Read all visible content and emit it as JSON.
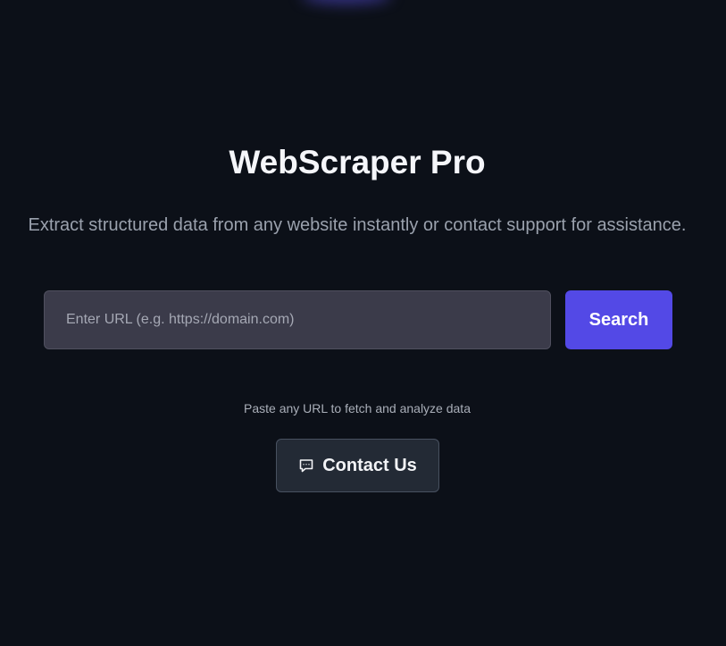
{
  "app": {
    "title": "WebScraper Pro",
    "subtitle": "Extract structured data from any website instantly or contact support for assistance."
  },
  "search": {
    "placeholder": "Enter URL (e.g. https://domain.com)",
    "value": "",
    "button_label": "Search",
    "hint": "Paste any URL to fetch and analyze data"
  },
  "contact": {
    "button_label": "Contact Us",
    "icon": "chat-bubble-icon"
  },
  "colors": {
    "background": "#0c1018",
    "accent": "#5349e6",
    "input_bg": "#3b3b4a",
    "contact_bg": "#232a35"
  }
}
